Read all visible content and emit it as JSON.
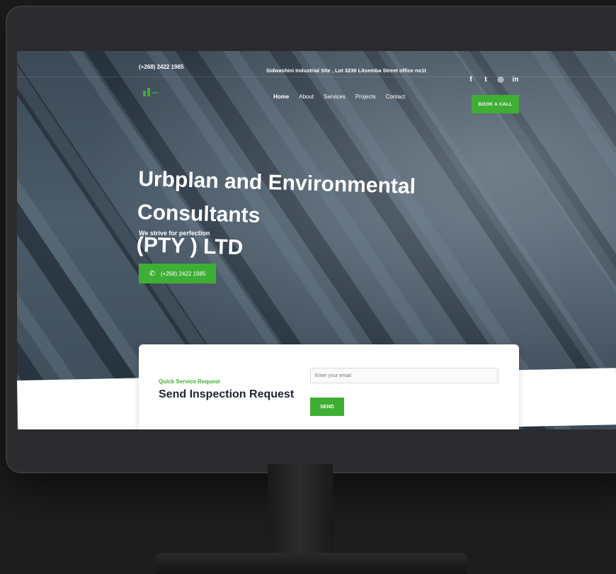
{
  "topbar": {
    "phone": "(+268) 2422 1985",
    "address": "Sidwashini Industrial Site , Lot 3236 Litsemba Street office no1t"
  },
  "social": [
    {
      "name": "facebook-icon",
      "glyph": "f"
    },
    {
      "name": "twitter-icon",
      "glyph": "t"
    },
    {
      "name": "instagram-icon",
      "glyph": "◎"
    },
    {
      "name": "linkedin-icon",
      "glyph": "in"
    }
  ],
  "nav": {
    "items": [
      "Home",
      "About",
      "Services",
      "Projects",
      "Contact"
    ],
    "book_label": "BOOK A CALL"
  },
  "hero": {
    "title_line1": "Urbplan and Environmental Consultants",
    "title_line2": "(PTY ) LTD",
    "subtitle": "We strive for perfection",
    "phone_label": "(+268) 2422 1985"
  },
  "request": {
    "kicker": "Quick Service Request",
    "title": "Send Inspection Request",
    "email_placeholder": "Enter your email",
    "send_label": "SEND"
  },
  "colors": {
    "accent": "#3fae35",
    "dark_text": "#1e2433"
  }
}
